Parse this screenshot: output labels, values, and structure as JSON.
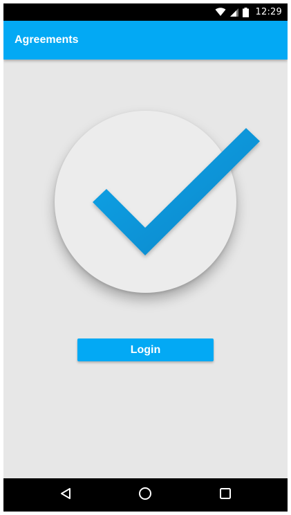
{
  "status_bar": {
    "time": "12:29",
    "icons": [
      "wifi-icon",
      "cell-signal-icon",
      "battery-icon"
    ]
  },
  "app_bar": {
    "title": "Agreements",
    "color": "#03a9f4"
  },
  "main": {
    "illustration": "check-icon",
    "check_color": "#0a9be0",
    "login_label": "Login"
  },
  "nav_bar": {
    "buttons": [
      "back-icon",
      "home-icon",
      "recent-apps-icon"
    ]
  }
}
